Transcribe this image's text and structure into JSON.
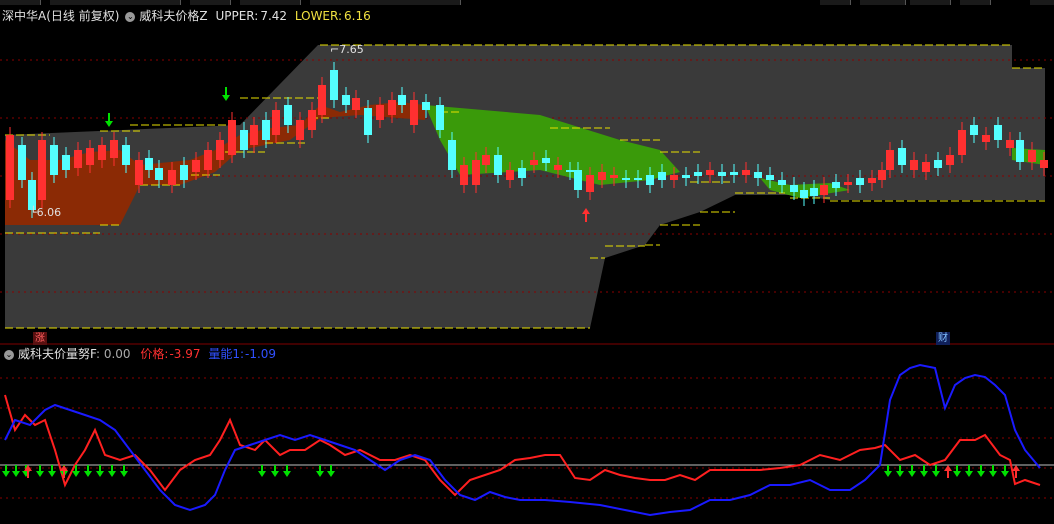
{
  "main_panel": {
    "title": "深中华A(日线 前复权)",
    "indicator_name": "威科夫价格Z",
    "upper_label": "UPPER:",
    "upper_value": "7.42",
    "lower_label": "LOWER:",
    "lower_value": "6.16",
    "high_annotation": "7.65",
    "low_annotation": "6.06",
    "badge_rise": "涨",
    "badge_finance": "财"
  },
  "sub_panel": {
    "indicator_name": "威科夫价量努F",
    "value0": ": 0.00",
    "price_label": "价格:",
    "price_value": "-3.97",
    "volume_label": "量能1:",
    "volume_value": "-1.09"
  },
  "colors": {
    "up": "#ff3030",
    "down": "#54ffff",
    "price_line": "#ff2020",
    "volume_line": "#1a1aff",
    "zone_gray": "#3a3a3a",
    "zone_brown": "#8b2a05",
    "zone_green": "#3a9a0a",
    "band_line": "#e8e000",
    "arrow_green": "#00e000"
  },
  "icons": [
    "settings-circle-icon",
    "up-arrow-icon",
    "down-arrow-icon"
  ]
}
